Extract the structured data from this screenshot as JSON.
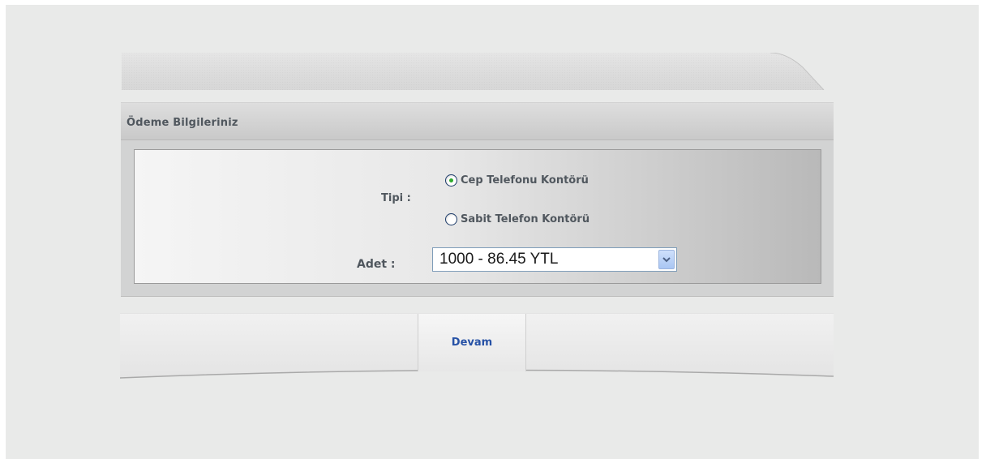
{
  "section": {
    "title": "Ödeme Bilgileriniz"
  },
  "form": {
    "type_label": "Tipi :",
    "type_options": [
      {
        "label": "Cep Telefonu Kontörü",
        "selected": true
      },
      {
        "label": "Sabit Telefon Kontörü",
        "selected": false
      }
    ],
    "quantity_label": "Adet :",
    "quantity_value": "1000 - 86.45 YTL"
  },
  "actions": {
    "continue_label": "Devam"
  },
  "colors": {
    "background": "#e9eae9",
    "label_text": "#50575e",
    "button_text": "#2752a6",
    "radio_dot": "#2eaa2e"
  }
}
